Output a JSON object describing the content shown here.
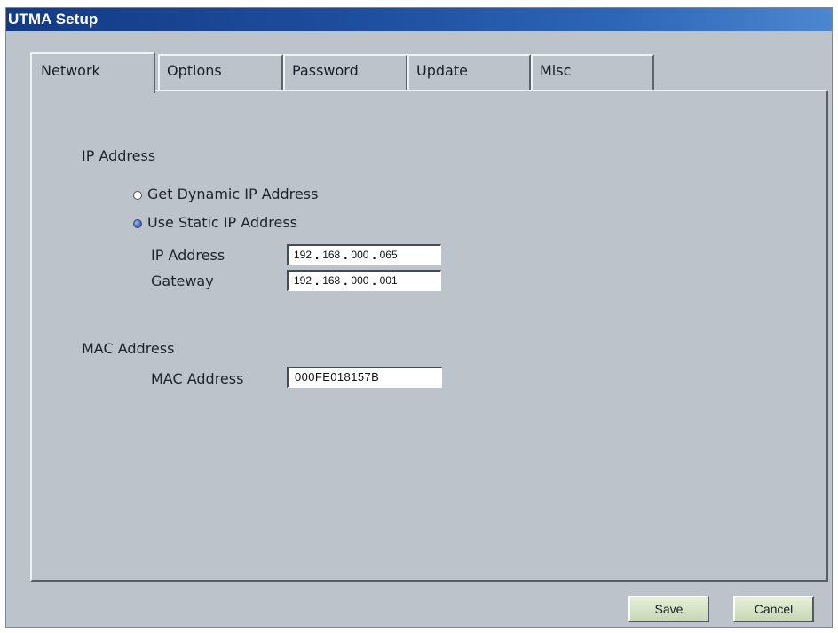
{
  "window": {
    "title": "UTMA Setup"
  },
  "tabs": [
    {
      "label": "Network",
      "active": true
    },
    {
      "label": "Options",
      "active": false
    },
    {
      "label": "Password",
      "active": false
    },
    {
      "label": "Update",
      "active": false
    },
    {
      "label": "Misc",
      "active": false
    }
  ],
  "network": {
    "ip_section": {
      "heading": "IP Address",
      "dynamic_option": {
        "label": "Get Dynamic IP Address",
        "selected": false
      },
      "static_option": {
        "label": "Use Static IP Address",
        "selected": true
      },
      "ip_address": {
        "label": "IP Address",
        "octets": [
          "192",
          "168",
          "000",
          "065"
        ]
      },
      "gateway": {
        "label": "Gateway",
        "octets": [
          "192",
          "168",
          "000",
          "001"
        ]
      }
    },
    "mac_section": {
      "heading": "MAC Address",
      "mac_address": {
        "label": "MAC Address",
        "value": "000FE018157B"
      }
    }
  },
  "buttons": {
    "save_label": "Save",
    "cancel_label": "Cancel"
  },
  "colors": {
    "titlebar_start": "#133a86",
    "titlebar_end": "#4d86d0",
    "window_bg": "#bcc3ca",
    "button_bg": "#d4e0c4",
    "radio_selected": "#4a6fc2"
  }
}
